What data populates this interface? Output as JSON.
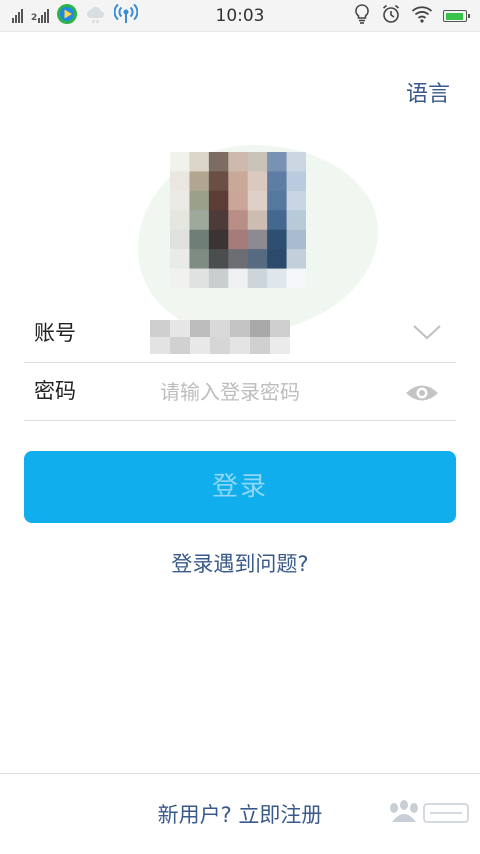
{
  "status_bar": {
    "time": "10:03",
    "signal_1_tag": "",
    "signal_2_tag": "2",
    "icons": [
      "signal-icon",
      "signal-2-icon",
      "video-app-icon",
      "cloud-icon",
      "hotspot-icon",
      "lightbulb-icon",
      "alarm-icon",
      "wifi-icon",
      "battery-icon"
    ],
    "battery_level": 0.95,
    "colors": {
      "battery_fill": "#39c24a",
      "video_app": "#2fb24a"
    }
  },
  "header": {
    "language_label": "语言"
  },
  "profile": {
    "avatar": "pixelated-profile-photo"
  },
  "form": {
    "account_label": "账号",
    "password_label": "密码",
    "password_placeholder": "请输入登录密码"
  },
  "actions": {
    "login_label": "登录",
    "help_label": "登录遇到问题?",
    "register_label": "新用户? 立即注册"
  },
  "theme": {
    "primary": "#10aeed",
    "link": "#3a5a8a",
    "divider": "#dddddd"
  }
}
